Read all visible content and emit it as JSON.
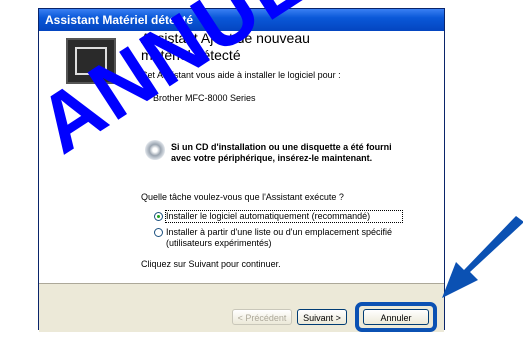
{
  "window": {
    "title": "Assistant Matériel détecté"
  },
  "header": {
    "heading": "Assistant Ajout de nouveau matériel détecté"
  },
  "body": {
    "intro": "Cet Assistant vous aide à installer le logiciel pour :",
    "device": "Brother MFC-8000 Series",
    "cd_text": "Si un CD d'installation ou une disquette a été fourni avec votre périphérique, insérez-le maintenant.",
    "question": "Quelle tâche voulez-vous que l'Assistant exécute ?",
    "options": [
      {
        "label": "Installer le logiciel automatiquement (recommandé)",
        "checked": true
      },
      {
        "label": "Installer à partir d'une liste ou d'un emplacement spécifié (utilisateurs expérimentés)",
        "checked": false
      }
    ],
    "continue_text": "Cliquez sur Suivant pour continuer."
  },
  "buttons": {
    "back": "< Précédent",
    "next": "Suivant >",
    "cancel": "Annuler"
  },
  "overlay": {
    "watermark": "ANNULER",
    "accent": "#0000ff",
    "arrow_icon": "arrow-pointing-to-cancel"
  }
}
